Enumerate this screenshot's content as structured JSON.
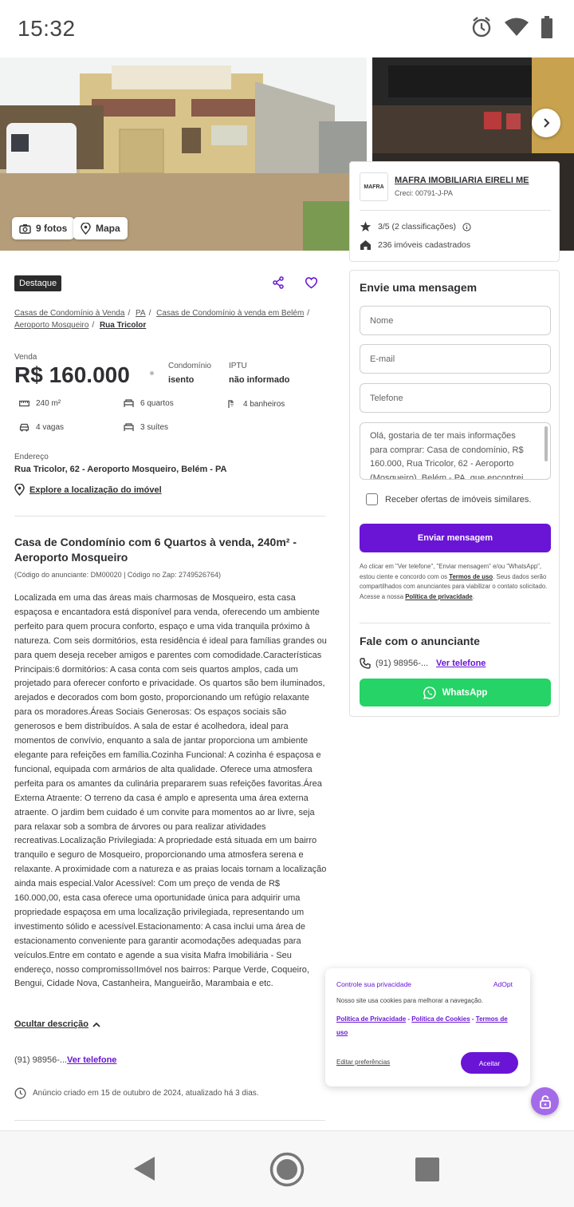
{
  "status_bar": {
    "time": "15:32"
  },
  "gallery": {
    "photos_label": "9 fotos",
    "map_label": "Mapa"
  },
  "listing": {
    "badge": "Destaque",
    "breadcrumbs": [
      "Casas de Condomínio à Venda",
      "PA",
      "Casas de Condomínio à venda em Belém",
      "Aeroporto Mosqueiro",
      "Rua Tricolor"
    ],
    "sale_label": "Venda",
    "price": "R$ 160.000",
    "condo_label": "Condomínio",
    "condo_value": "isento",
    "iptu_label": "IPTU",
    "iptu_value": "não informado",
    "features": {
      "area": "240 m²",
      "bedrooms": "6 quartos",
      "bathrooms": "4 banheiros",
      "parking": "4 vagas",
      "suites": "3 suítes"
    },
    "address_label": "Endereço",
    "address": "Rua Tricolor, 62 - Aeroporto Mosqueiro, Belém - PA",
    "explore_label": "Explore a localização do imóvel",
    "title": "Casa de Condomínio com 6 Quartos à venda, 240m² - Aeroporto Mosqueiro",
    "codes": "(Código do anunciante: DM00020 | Código no Zap: 2749526764)",
    "description": "Localizada em uma das áreas mais charmosas de Mosqueiro, esta casa espaçosa e encantadora está disponível para venda, oferecendo um ambiente perfeito para quem procura conforto, espaço e uma vida tranquila próximo à natureza. Com seis dormitórios, esta residência é ideal para famílias grandes ou para quem deseja receber amigos e parentes com comodidade.Características Principais:6 dormitórios: A casa conta com seis quartos amplos, cada um projetado para oferecer conforto e privacidade. Os quartos são bem iluminados, arejados e decorados com bom gosto, proporcionando um refúgio relaxante para os moradores.Áreas Sociais Generosas: Os espaços sociais são generosos e bem distribuídos. A sala de estar é acolhedora, ideal para momentos de convívio, enquanto a sala de jantar proporciona um ambiente elegante para refeições em família.Cozinha Funcional: A cozinha é espaçosa e funcional, equipada com armários de alta qualidade. Oferece uma atmosfera perfeita para os amantes da culinária prepararem suas refeições favoritas.Área Externa Atraente: O terreno da casa é amplo e apresenta uma área externa atraente. O jardim bem cuidado é um convite para momentos ao ar livre, seja para relaxar sob a sombra de árvores ou para realizar atividades recreativas.Localização Privilegiada: A propriedade está situada em um bairro tranquilo e seguro de Mosqueiro, proporcionando uma atmosfera serena e relaxante. A proximidade com a natureza e as praias locais tornam a localização ainda mais especial.Valor Acessível: Com um preço de venda de R$ 160.000,00, esta casa oferece uma oportunidade única para adquirir uma propriedade espaçosa em uma localização privilegiada, representando um investimento sólido e acessível.Estacionamento: A casa inclui uma área de estacionamento conveniente para garantir acomodações adequadas para veículos.Entre em contato e agende a sua visita Mafra Imobiliária - Seu endereço, nosso compromisso!Imóvel nos bairros: Parque Verde, Coqueiro, Bengui, Cidade Nova, Castanheira, Mangueirão, Marambaia e etc.",
    "hide_description": "Ocultar descrição",
    "phone_partial": "(91) 98956-...",
    "see_phone": "Ver telefone",
    "created": "Anúncio criado em 15 de outubro de 2024, atualizado há 3 dias."
  },
  "agency": {
    "logo_text": "MAFRA",
    "name": "MAFRA IMOBILIARIA EIRELI ME",
    "creci": "Creci: 00791-J-PA",
    "rating": "3/5 (2 classificações)",
    "listings": "236 imóveis cadastrados"
  },
  "message_form": {
    "title": "Envie uma mensagem",
    "name_placeholder": "Nome",
    "email_placeholder": "E-mail",
    "phone_placeholder": "Telefone",
    "message": "Olá, gostaria de ter mais informações para comprar: Casa de condomínio, R$ 160.000, Rua Tricolor, 62 - Aeroporto (Mosqueiro), Belém - PA, que encontrei",
    "similar_offers": "Receber ofertas de imóveis similares.",
    "send_button": "Enviar mensagem",
    "terms_prefix": "Ao clicar em \"Ver telefone\", \"Enviar mensagem\" e/ou \"WhatsApp\", estou ciente e concordo com os ",
    "terms_link": "Termos de uso",
    "terms_middle": ". Seus dados serão compartilhados com anunciantes para viabilizar o contato solicitado. Acesse a nossa ",
    "privacy_link": "Política de privacidade",
    "terms_suffix": ".",
    "contact_title": "Fale com o anunciante",
    "phone_partial": "(91) 98956-...",
    "see_phone": "Ver telefone",
    "whatsapp": "WhatsApp"
  },
  "privacy_popup": {
    "title": "Controle sua privacidade",
    "brand": "AdOpt",
    "text": "Nosso site usa cookies para melhorar a navegação.",
    "policy_link": "Política de Privacidade",
    "cookies_link": "Política de Cookies",
    "terms_link": "Termos de uso",
    "separator": "-",
    "edit": "Editar preferências",
    "accept": "Aceitar"
  },
  "colors": {
    "accent": "#6a15d6",
    "whatsapp": "#25d366"
  }
}
